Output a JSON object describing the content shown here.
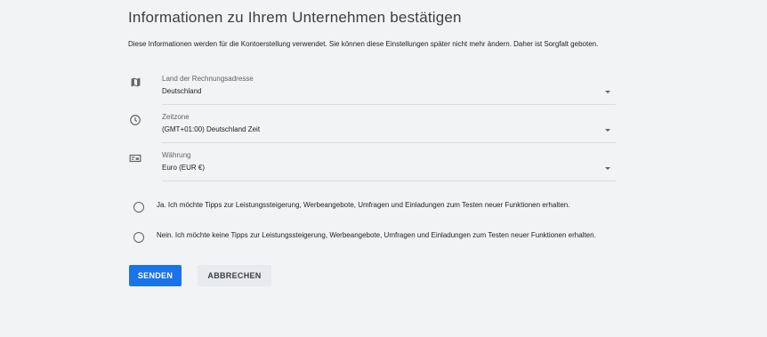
{
  "title": "Informationen zu Ihrem Unternehmen bestätigen",
  "description": "Diese Informationen werden für die Kontoerstellung verwendet. Sie können diese Einstellungen später nicht mehr ändern. Daher ist Sorgfalt geboten.",
  "fields": {
    "country": {
      "label": "Land der Rechnungsadresse",
      "value": "Deutschland",
      "icon": "map-icon"
    },
    "timezone": {
      "label": "Zeitzone",
      "value": "(GMT+01:00) Deutschland Zeit",
      "icon": "clock-icon"
    },
    "currency": {
      "label": "Währung",
      "value": "Euro (EUR €)",
      "icon": "currency-icon"
    }
  },
  "options": {
    "yes": "Ja. Ich möchte Tipps zur Leistungssteigerung, Werbeangebote, Umfragen und Einladungen zum Testen neuer Funktionen erhalten.",
    "no": "Nein. Ich möchte keine Tipps zur Leistungssteigerung, Werbeangebote, Umfragen und Einladungen zum Testen neuer Funktionen erhalten."
  },
  "buttons": {
    "submit": "SENDEN",
    "cancel": "ABBRECHEN"
  },
  "colors": {
    "accent": "#1a73e8",
    "background": "#f1f3f4",
    "icon": "#5f6368"
  }
}
